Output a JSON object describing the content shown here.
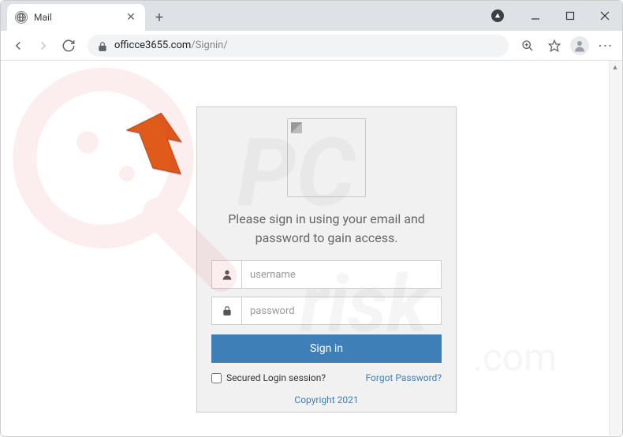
{
  "browser": {
    "tab_title": "Mail",
    "url_domain": "officce3655.com",
    "url_path": "/Signin/"
  },
  "login": {
    "message": "Please sign in using your email and password to gain access.",
    "username_placeholder": "username",
    "password_placeholder": "password",
    "signin_button": "Sign in",
    "secured_label": "Secured Login session?",
    "forgot_label": "Forgot Password?",
    "copyright": "Copyright 2021"
  },
  "watermark": "pcrisk.com"
}
